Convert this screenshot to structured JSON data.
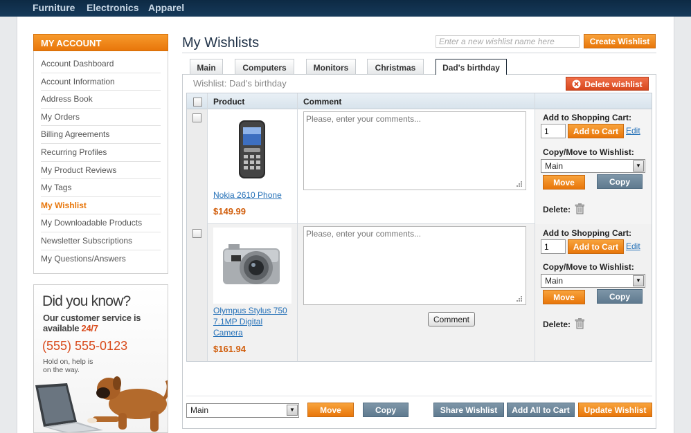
{
  "topnav": [
    "Furniture",
    "Electronics",
    "Apparel"
  ],
  "sidebar": {
    "heading": "MY ACCOUNT",
    "items": [
      {
        "label": "Account Dashboard",
        "active": false
      },
      {
        "label": "Account Information",
        "active": false
      },
      {
        "label": "Address Book",
        "active": false
      },
      {
        "label": "My Orders",
        "active": false
      },
      {
        "label": "Billing Agreements",
        "active": false
      },
      {
        "label": "Recurring Profiles",
        "active": false
      },
      {
        "label": "My Product Reviews",
        "active": false
      },
      {
        "label": "My Tags",
        "active": false
      },
      {
        "label": "My Wishlist",
        "active": true
      },
      {
        "label": "My Downloadable Products",
        "active": false
      },
      {
        "label": "Newsletter Subscriptions",
        "active": false
      },
      {
        "label": "My Questions/Answers",
        "active": false
      }
    ]
  },
  "promo": {
    "title": "Did you know?",
    "line1": "Our customer service is",
    "line2_prefix": "available ",
    "line2_hours": "24/7",
    "phone": "(555) 555-0123",
    "tagline_1": "Hold on, help is",
    "tagline_2": "on the way."
  },
  "header": {
    "title": "My Wishlists",
    "new_wishlist_placeholder": "Enter a new wishlist name here",
    "create_label": "Create Wishlist"
  },
  "tabs": [
    {
      "label": "Main",
      "active": false
    },
    {
      "label": "Computers",
      "active": false
    },
    {
      "label": "Monitors",
      "active": false
    },
    {
      "label": "Christmas",
      "active": false
    },
    {
      "label": "Dad's birthday",
      "active": true
    }
  ],
  "wishlist": {
    "name_prefix": "Wishlist: ",
    "name": "Dad's birthday",
    "delete_label": "Delete wishlist",
    "columns": {
      "product": "Product",
      "comment": "Comment"
    },
    "row_labels": {
      "add_to_cart": "Add to Shopping Cart:",
      "add_button": "Add to Cart",
      "edit": "Edit",
      "copy_move": "Copy/Move to Wishlist:",
      "move": "Move",
      "copy": "Copy",
      "delete": "Delete:"
    },
    "items": [
      {
        "name": "Nokia 2610 Phone",
        "price": "$149.99",
        "comment_placeholder": "Please, enter your comments...",
        "qty": "1",
        "target_wishlist": "Main"
      },
      {
        "name_line1": "Olympus Stylus 750",
        "name_line2": "7.1MP Digital",
        "name_line3": "Camera",
        "price": "$161.94",
        "comment_placeholder": "Please, enter your comments...",
        "qty": "1",
        "target_wishlist": "Main",
        "comment_button": "Comment"
      }
    ]
  },
  "footer": {
    "target_wishlist": "Main",
    "move": "Move",
    "copy": "Copy",
    "share": "Share Wishlist",
    "add_all": "Add All to Cart",
    "update": "Update Wishlist"
  },
  "colors": {
    "accent_orange": "#e8760a",
    "navy": "#0d2a44",
    "link_blue": "#2571b8",
    "price_orange": "#d15e0c"
  }
}
